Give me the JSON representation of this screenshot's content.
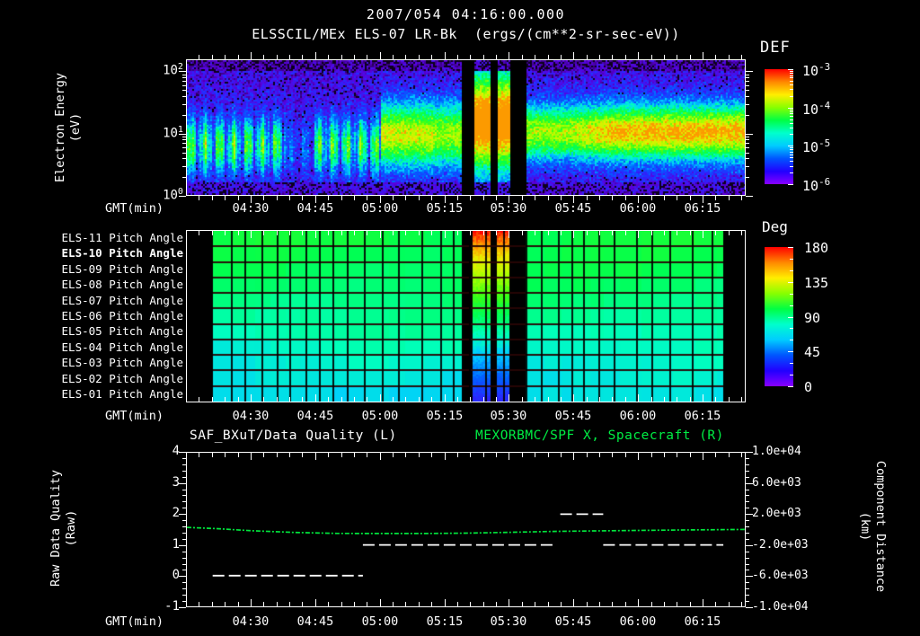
{
  "header": {
    "datetime_title": "2007/054 04:16:00.000",
    "subtitle": "ELSSCIL/MEx ELS-07 LR-Bk  (ergs/(cm**2-sr-sec-eV))"
  },
  "colors": {
    "background": "#000000",
    "text": "#ffffff",
    "green_series": "#00e53c",
    "green_title": "#00ee44",
    "rainbow_top_to_bottom": [
      "#ff0000",
      "#ff8800",
      "#ffee00",
      "#88ff00",
      "#00ff44",
      "#00ffcc",
      "#00ccff",
      "#0055ff",
      "#2200ff",
      "#8800ff"
    ]
  },
  "panels": {
    "spectrogram": {
      "ylabel_lines": [
        "Electron Energy",
        "(eV)"
      ],
      "y_tick_labels": [
        {
          "base": "10",
          "exp": "2"
        },
        {
          "base": "10",
          "exp": "1"
        },
        {
          "base": "10",
          "exp": "0"
        }
      ],
      "colorbar": {
        "title": "DEF",
        "tick_labels": [
          {
            "base": "10",
            "exp": "-3"
          },
          {
            "base": "10",
            "exp": "-4"
          },
          {
            "base": "10",
            "exp": "-5"
          },
          {
            "base": "10",
            "exp": "-6"
          }
        ]
      },
      "xaxis_label": "GMT(min)",
      "x_tick_labels": [
        "04:30",
        "04:45",
        "05:00",
        "05:15",
        "05:30",
        "05:45",
        "06:00",
        "06:15"
      ]
    },
    "pitch": {
      "row_labels": [
        "ELS-11 Pitch Angle",
        "ELS-10 Pitch Angle",
        "ELS-09 Pitch Angle",
        "ELS-08 Pitch Angle",
        "ELS-07 Pitch Angle",
        "ELS-06 Pitch Angle",
        "ELS-05 Pitch Angle",
        "ELS-04 Pitch Angle",
        "ELS-03 Pitch Angle",
        "ELS-02 Pitch Angle",
        "ELS-01 Pitch Angle"
      ],
      "highlighted_row": "ELS-10 Pitch Angle",
      "colorbar": {
        "title": "Deg",
        "tick_labels": [
          "180",
          "135",
          "90",
          "45",
          "0"
        ]
      },
      "xaxis_label": "GMT(min)",
      "x_tick_labels": [
        "04:30",
        "04:45",
        "05:00",
        "05:15",
        "05:30",
        "05:45",
        "06:00",
        "06:15"
      ]
    },
    "timeseries": {
      "title_left": "SAF_BXuT/Data Quality (L)",
      "title_right": "MEXORBMC/SPF X, Spacecraft (R)",
      "ylabel_left_lines": [
        "Raw Data Quality",
        "(Raw)"
      ],
      "ylabel_right_lines": [
        "Component Distance",
        "(km)"
      ],
      "y_tick_labels_left": [
        "4",
        "3",
        "2",
        "1",
        "0",
        "-1"
      ],
      "y_tick_labels_right": [
        "1.0e+04",
        "6.0e+03",
        "2.0e+03",
        "-2.0e+03",
        "-6.0e+03",
        "-1.0e+04"
      ],
      "xaxis_label": "GMT(min)",
      "x_tick_labels": [
        "04:30",
        "04:45",
        "05:00",
        "05:15",
        "05:30",
        "05:45",
        "06:00",
        "06:15"
      ]
    }
  },
  "chart_data": [
    {
      "type": "heatmap",
      "name": "electron_energy_spectrogram",
      "title": "ELSSCIL/MEx ELS-07 LR-Bk",
      "units": "ergs/(cm**2-sr-sec-eV)",
      "x_start_gmt": "04:15",
      "x_end_gmt": "06:25",
      "x_major_ticks": [
        "04:30",
        "04:45",
        "05:00",
        "05:15",
        "05:30",
        "05:45",
        "06:00",
        "06:15"
      ],
      "y_scale": "log",
      "y_range_ev": [
        1,
        160
      ],
      "y_ticks_ev": [
        1,
        10,
        100
      ],
      "colorbar": {
        "title": "DEF",
        "min": 1e-06,
        "max": 0.001
      },
      "data_gaps_gmt": [
        [
          "05:19",
          "05:21"
        ],
        [
          "05:26",
          "05:27"
        ],
        [
          "05:30",
          "05:34"
        ]
      ],
      "bright_columns_gmt": [
        [
          "05:21",
          "05:26"
        ],
        [
          "05:27",
          "05:30"
        ]
      ],
      "features": [
        "Noisy blue/violet background (~1e-6 to 1e-5) at high and very low energies",
        "Patchy green flux band (~1e-4) between roughly 4 and 40 eV before 05:00",
        "Band dims near 04:38-04:45",
        "Continuous smooth band after 05:34, brightening to yellow-green core (~10-30 eV) after 05:45",
        "Full-energy high-flux columns (yellow core) between the three black telemetry gaps"
      ]
    },
    {
      "type": "heatmap",
      "name": "pitch_angle_panel",
      "rows_top_to_bottom": [
        "ELS-11",
        "ELS-10",
        "ELS-09",
        "ELS-08",
        "ELS-07",
        "ELS-06",
        "ELS-05",
        "ELS-04",
        "ELS-03",
        "ELS-02",
        "ELS-01"
      ],
      "colorbar": {
        "title": "Deg",
        "min": 0,
        "max": 180
      },
      "typical_row_values_deg": [
        108,
        106,
        104,
        101,
        98,
        94,
        90,
        86,
        82,
        79,
        76
      ],
      "data_start_gmt": "04:21",
      "data_end_gmt": "06:20",
      "data_gaps_gmt": [
        [
          "05:19",
          "05:21"
        ],
        [
          "05:26",
          "05:27"
        ],
        [
          "05:30",
          "05:34"
        ]
      ],
      "sweep_columns_gmt": [
        [
          "05:21",
          "05:26"
        ],
        [
          "05:27",
          "05:30"
        ]
      ],
      "sweep_range_deg": [
        180,
        30
      ],
      "features": [
        "Mostly uniform green (~90-110 deg) cells; lower anodes shade toward cyan (~75-85 deg)",
        "During sweep columns pitch angle runs red (180) at ELS-11 down to blue-violet (~30) at ELS-01"
      ]
    },
    {
      "type": "line",
      "name": "quality_and_distance",
      "x_start_gmt": "04:15",
      "x_end_gmt": "06:25",
      "ylim_left": [
        -1,
        4
      ],
      "ylim_right": [
        -10000,
        10000
      ],
      "series": [
        {
          "name": "SAF_BXuT/Data Quality (L)",
          "color": "#ffffff",
          "style": "dashed",
          "axis": "left",
          "segments": [
            {
              "t_start": "04:21",
              "t_end": "04:56",
              "value": 0
            },
            {
              "t_start": "04:56",
              "t_end": "05:41",
              "value": 1
            },
            {
              "t_start": "05:42",
              "t_end": "05:52",
              "value": 2
            },
            {
              "t_start": "05:52",
              "t_end": "06:20",
              "value": 1
            }
          ]
        },
        {
          "name": "MEXORBMC/SPF X, Spacecraft (R)",
          "color": "#00e53c",
          "style": "dash-dot",
          "axis": "right",
          "units": "km",
          "points": [
            {
              "t": "04:15",
              "km": 280
            },
            {
              "t": "04:22",
              "km": 120
            },
            {
              "t": "04:30",
              "km": -150
            },
            {
              "t": "04:40",
              "km": -380
            },
            {
              "t": "04:50",
              "km": -500
            },
            {
              "t": "05:00",
              "km": -520
            },
            {
              "t": "05:10",
              "km": -520
            },
            {
              "t": "05:20",
              "km": -470
            },
            {
              "t": "05:30",
              "km": -360
            },
            {
              "t": "05:40",
              "km": -250
            },
            {
              "t": "05:50",
              "km": -170
            },
            {
              "t": "06:00",
              "km": -120
            },
            {
              "t": "06:10",
              "km": -60
            },
            {
              "t": "06:25",
              "km": 10
            }
          ]
        }
      ]
    }
  ]
}
